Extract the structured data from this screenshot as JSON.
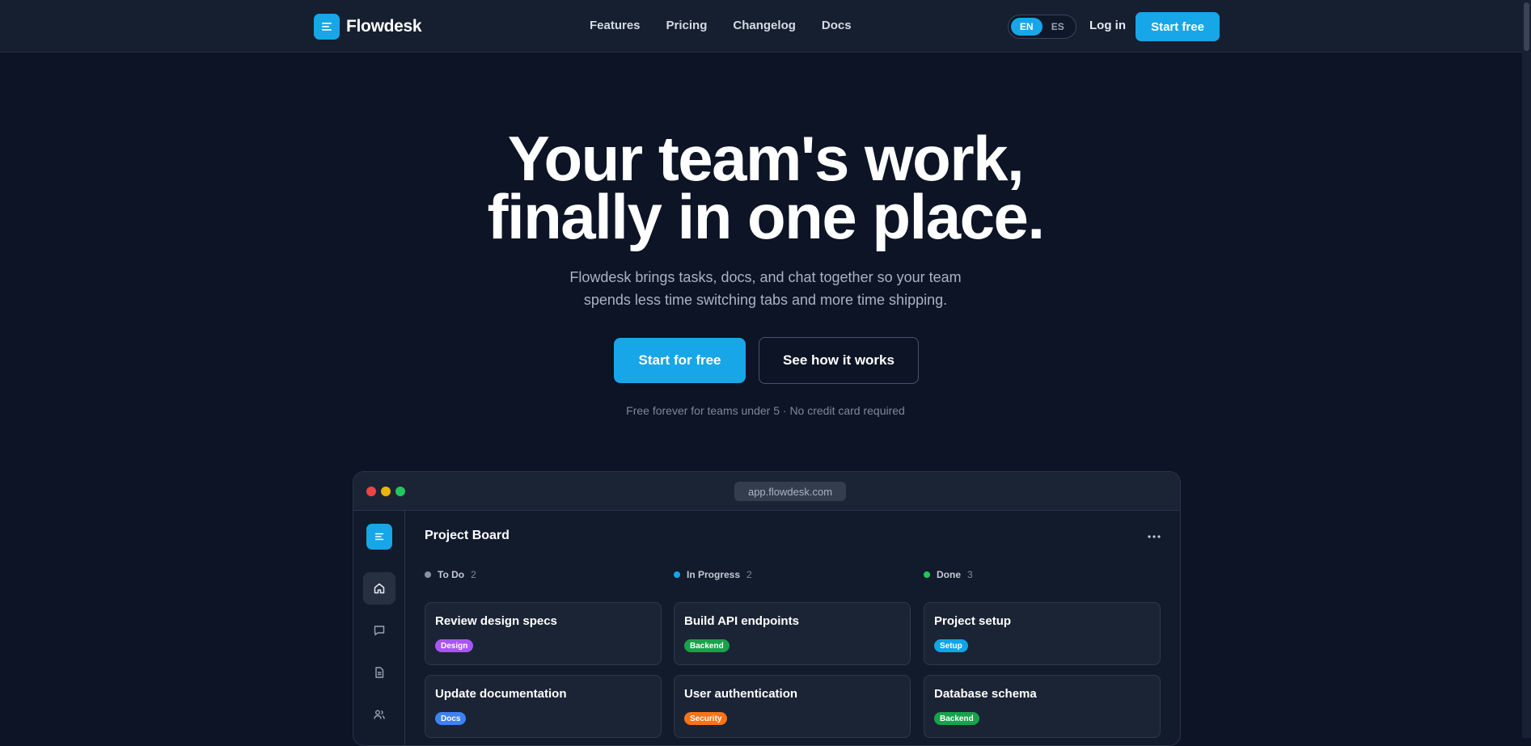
{
  "nav": {
    "brand": "Flowdesk",
    "links": [
      "Features",
      "Pricing",
      "Changelog",
      "Docs"
    ],
    "lang": [
      "EN",
      "ES"
    ],
    "login": "Log in",
    "cta": "Start free"
  },
  "hero": {
    "line1": "Your team's work,",
    "line2_pre": "finally in ",
    "line2_em": "one",
    "line2_post": " place.",
    "sub1": "Flowdesk brings tasks, docs, and chat together so your team",
    "sub2": "spends less time switching tabs and more time shipping.",
    "primary": "Start for free",
    "secondary": "See how it works",
    "note": "Free forever for teams under 5 · No credit card required"
  },
  "app": {
    "url": "app.flowdesk.com",
    "board_title": "Project Board",
    "columns": [
      {
        "name": "To Do",
        "count": "2",
        "color": "#8b93a1",
        "cards": [
          {
            "title": "Review design specs",
            "tag": "Design",
            "tag_color": "#a855f7"
          },
          {
            "title": "Update documentation",
            "tag": "Docs",
            "tag_color": "#3b82f6"
          }
        ]
      },
      {
        "name": "In Progress",
        "count": "2",
        "color": "#17a6e8",
        "cards": [
          {
            "title": "Build API endpoints",
            "tag": "Backend",
            "tag_color": "#16a34a"
          },
          {
            "title": "User authentication",
            "tag": "Security",
            "tag_color": "#f97316"
          }
        ]
      },
      {
        "name": "Done",
        "count": "3",
        "color": "#22c55e",
        "cards": [
          {
            "title": "Project setup",
            "tag": "Setup",
            "tag_color": "#0ea5e9"
          },
          {
            "title": "Database schema",
            "tag": "Backend",
            "tag_color": "#16a34a"
          }
        ]
      }
    ]
  },
  "colors": {
    "accent": "#17a6e8",
    "bg": "#0c1425"
  }
}
